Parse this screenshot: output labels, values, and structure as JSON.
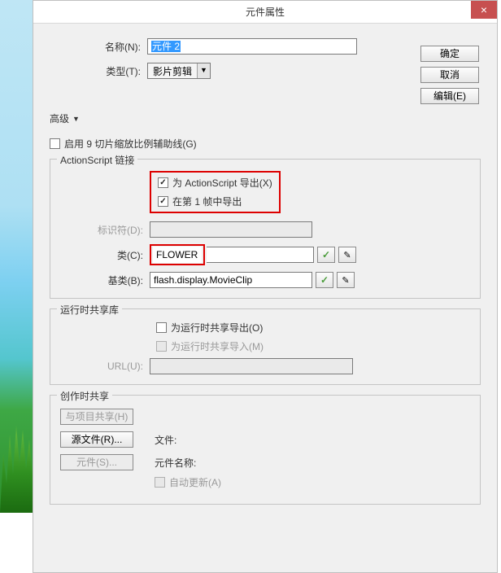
{
  "title": "元件属性",
  "buttons": {
    "ok": "确定",
    "cancel": "取消",
    "edit": "编辑(E)"
  },
  "form": {
    "name_label": "名称(N):",
    "name_value": "元件 2",
    "type_label": "类型(T):",
    "type_value": "影片剪辑"
  },
  "advanced_label": "高级",
  "nine_slice": {
    "label": "启用 9 切片缩放比例辅助线(G)"
  },
  "as_link": {
    "legend": "ActionScript 链接",
    "export_as": "为 ActionScript 导出(X)",
    "export_frame1": "在第 1 帧中导出",
    "identifier_label": "标识符(D):",
    "class_label": "类(C):",
    "class_value": "FLOWER",
    "base_label": "基类(B):",
    "base_value": "flash.display.MovieClip"
  },
  "rt_share": {
    "legend": "运行时共享库",
    "export_label": "为运行时共享导出(O)",
    "import_label": "为运行时共享导入(M)",
    "url_label": "URL(U):"
  },
  "author_share": {
    "legend": "创作时共享",
    "share_project": "与项目共享(H)",
    "source_file": "源文件(R)...",
    "symbol": "元件(S)...",
    "file_label": "文件:",
    "symbol_name_label": "元件名称:",
    "auto_update": "自动更新(A)"
  }
}
